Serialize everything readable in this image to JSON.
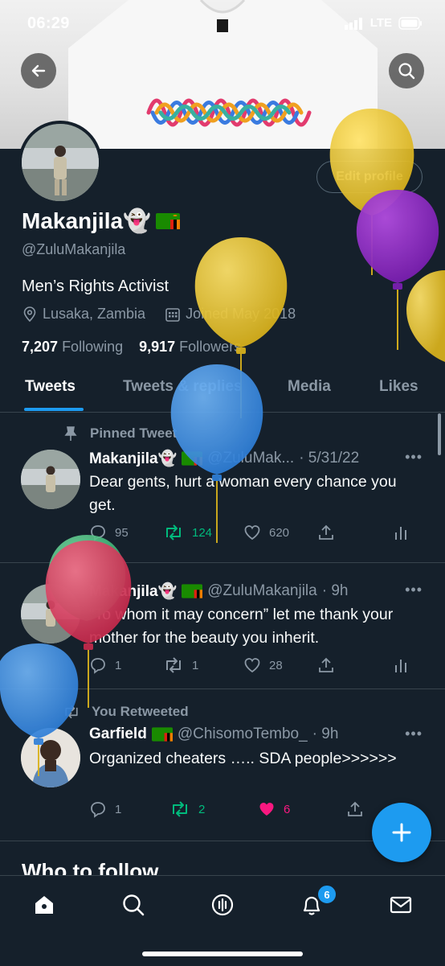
{
  "status_bar": {
    "time": "06:29",
    "network": "LTE"
  },
  "profile": {
    "display_name": "Makanjila👻",
    "handle": "@ZuluMakanjila",
    "bio": "Men’s Rights Activist",
    "location": "Lusaka, Zambia",
    "joined": "Joined May 2018",
    "following_count": "7,207",
    "following_label": "Following",
    "followers_count": "9,917",
    "followers_label": "Followers",
    "edit_profile_label": "Edit profile"
  },
  "tabs": [
    {
      "label": "Tweets",
      "active": true
    },
    {
      "label": "Tweets & replies",
      "active": false
    },
    {
      "label": "Media",
      "active": false
    },
    {
      "label": "Likes",
      "active": false
    }
  ],
  "tweets": [
    {
      "context": "Pinned Tweet",
      "name": "Makanjila👻",
      "handle": "@ZuluMak...",
      "time": "· 5/31/22",
      "text": "Dear gents, hurt a woman every chance you get.",
      "replies": "95",
      "retweets": "124",
      "likes": "620",
      "retweeted": true,
      "liked": false
    },
    {
      "context": "",
      "name": "Makanjila👻",
      "handle": "@ZuluMakanjila",
      "time": "· 9h",
      "text": "“To whom it may concern” let me thank your mother for the beauty you inherit.",
      "replies": "1",
      "retweets": "1",
      "likes": "28",
      "retweeted": false,
      "liked": false
    },
    {
      "context": "You Retweeted",
      "name": "Garfield",
      "handle": "@ChisomoTembo_",
      "time": "· 9h",
      "text": "Organized cheaters ….. SDA people>>>>>>",
      "replies": "1",
      "retweets": "2",
      "likes": "6",
      "retweeted": true,
      "liked": true
    }
  ],
  "who_to_follow": "Who to follow",
  "notifications_badge": "6",
  "colors": {
    "accent": "#1d9bf0",
    "background": "#15202b",
    "retweet_green": "#00ba7c",
    "like_pink": "#f91880",
    "muted": "#8b98a5"
  }
}
